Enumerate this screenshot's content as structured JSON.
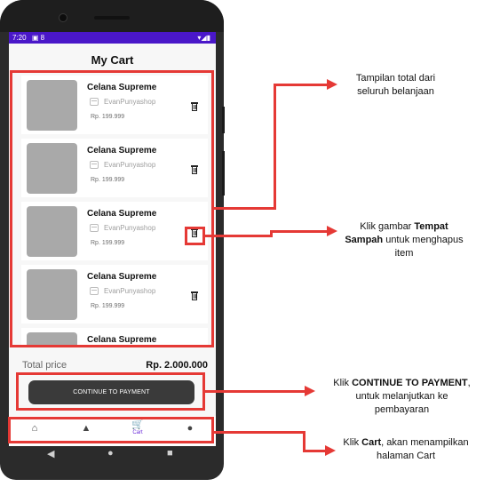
{
  "status_bar": {
    "time": "7:20",
    "icons_left": "▣ 8",
    "icons_right": "▾◢▮"
  },
  "screen": {
    "title": "My Cart"
  },
  "cart_items": [
    {
      "name": "Celana Supreme",
      "shop": "EvanPunyashop",
      "price": "Rp. 199.999"
    },
    {
      "name": "Celana Supreme",
      "shop": "EvanPunyashop",
      "price": "Rp. 199.999"
    },
    {
      "name": "Celana Supreme",
      "shop": "EvanPunyashop",
      "price": "Rp. 199.999"
    },
    {
      "name": "Celana Supreme",
      "shop": "EvanPunyashop",
      "price": "Rp. 199.999"
    },
    {
      "name": "Celana Supreme",
      "shop": "",
      "price": ""
    }
  ],
  "summary": {
    "total_label": "Total price",
    "total_value": "Rp. 2.000.000"
  },
  "pay_button": {
    "label": "CONTINUE TO PAYMENT"
  },
  "bottom_nav": {
    "home_icon": "home-icon",
    "category_icon": "shapes-icon",
    "cart_label": "Cart",
    "cart_icon": "cart-icon",
    "profile_icon": "person-icon"
  },
  "system_nav": {
    "back": "◀",
    "home": "●",
    "recent": "■"
  },
  "annotations": {
    "total": {
      "line1": "Tampilan total dari",
      "line2": "seluruh belanjaan"
    },
    "trash": {
      "pre": "Klik gambar ",
      "bold1": "Tempat",
      "bold2": "Sampah",
      "post": " untuk menghapus",
      "line3": "item"
    },
    "payment": {
      "pre": "Klik ",
      "bold": "CONTINUE TO PAYMENT",
      "post": ",",
      "line2": "untuk melanjutkan ke",
      "line3": "pembayaran"
    },
    "cart": {
      "pre": "Klik ",
      "bold": "Cart",
      "post": ", akan menampilkan",
      "line2": "halaman Cart"
    }
  },
  "colors": {
    "highlight": "#e53935",
    "status_bar": "#4a17c9",
    "accent": "#6a2bd9",
    "button": "#3a3a3a"
  }
}
